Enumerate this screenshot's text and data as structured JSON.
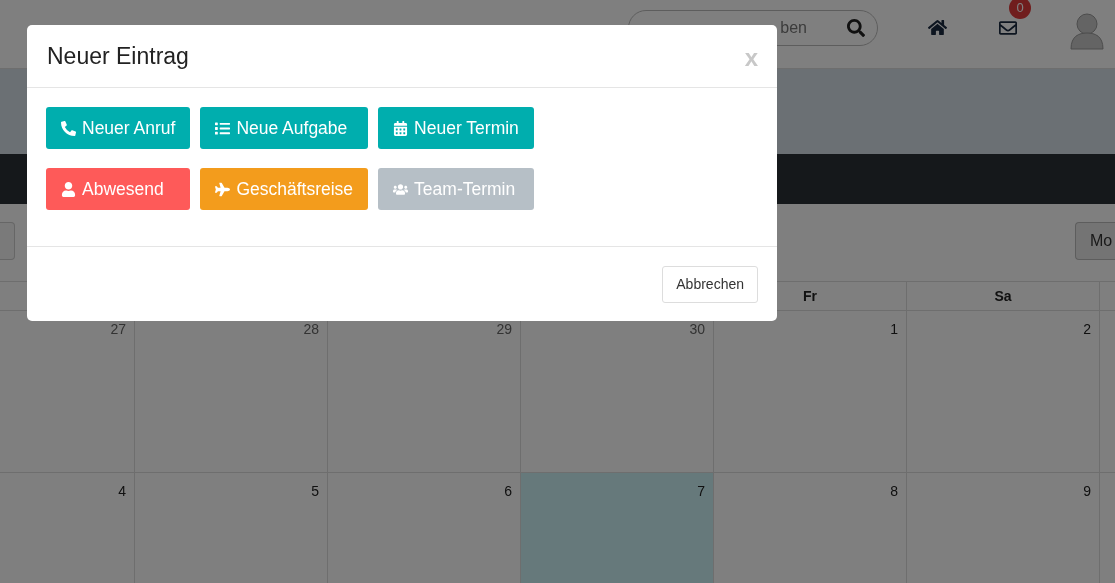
{
  "navbar": {
    "search": {
      "placeholder": "ben"
    },
    "notification_count": "0"
  },
  "toolbar": {
    "view_button": "Mo"
  },
  "calendar": {
    "columns": [
      {},
      {},
      {},
      {},
      {
        "header": "Fr"
      },
      {
        "header": "Sa"
      },
      {}
    ],
    "weeks": [
      {
        "days": [
          {
            "label": "27",
            "today": false,
            "other_month": true
          },
          {
            "label": "28",
            "today": false,
            "other_month": true
          },
          {
            "label": "29",
            "today": false,
            "other_month": true
          },
          {
            "label": "30",
            "today": false,
            "other_month": true
          },
          {
            "label": "1",
            "today": false,
            "other_month": false
          },
          {
            "label": "2",
            "today": false,
            "other_month": false
          }
        ]
      },
      {
        "days": [
          {
            "label": "4",
            "today": false,
            "other_month": false
          },
          {
            "label": "5",
            "today": false,
            "other_month": false
          },
          {
            "label": "6",
            "today": false,
            "other_month": false
          },
          {
            "label": "7",
            "today": true,
            "other_month": false
          },
          {
            "label": "8",
            "today": false,
            "other_month": false
          },
          {
            "label": "9",
            "today": false,
            "other_month": false
          }
        ]
      }
    ]
  },
  "modal": {
    "title": "Neuer Eintrag",
    "close": "x",
    "buttons": [
      {
        "kind": "call",
        "label": "Neuer Anruf",
        "color": "#00aeae"
      },
      {
        "kind": "task",
        "label": "Neue Aufgabe",
        "color": "#00aeae"
      },
      {
        "kind": "appointment",
        "label": "Neuer Termin",
        "color": "#00aeae"
      },
      {
        "kind": "absence",
        "label": "Abwesend",
        "color": "#fe5a59"
      },
      {
        "kind": "trip",
        "label": "Geschäftsreise",
        "color": "#f39c1c"
      },
      {
        "kind": "team",
        "label": "Team-Termin",
        "color": "#b6bfc6"
      }
    ],
    "cancel": "Abbrechen"
  }
}
